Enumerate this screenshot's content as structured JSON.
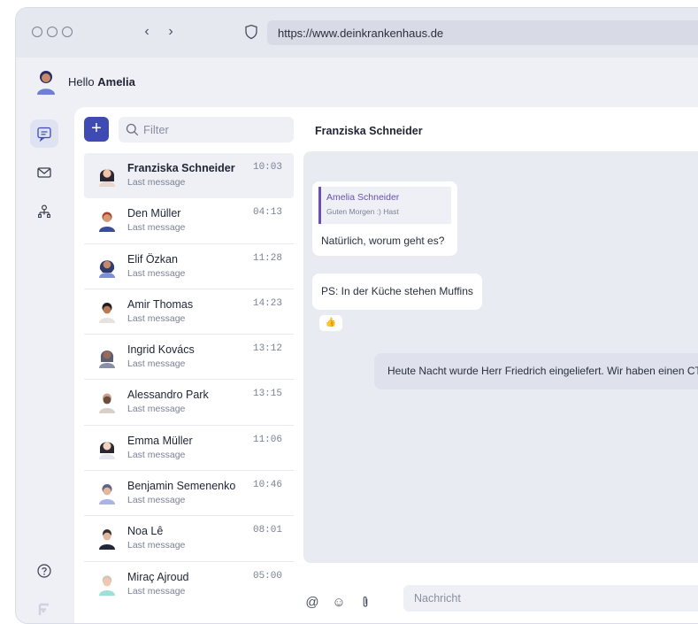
{
  "browser": {
    "url": "https://www.deinkrankenhaus.de",
    "back": "‹",
    "forward": "›"
  },
  "header": {
    "greeting": "Hello",
    "user_name": "Amelia"
  },
  "sidebar": {
    "icons": [
      "chat-icon",
      "mail-icon",
      "org-chart-icon"
    ],
    "help_icon": "help-icon",
    "logo_icon": "app-logo-icon"
  },
  "chat_list": {
    "add_label": "+",
    "filter_placeholder": "Filter",
    "items": [
      {
        "name": "Franziska Schneider",
        "subtitle": "Last message",
        "time": "10:03"
      },
      {
        "name": "Den Müller",
        "subtitle": "Last message",
        "time": "04:13"
      },
      {
        "name": "Elif Özkan",
        "subtitle": "Last message",
        "time": "11:28"
      },
      {
        "name": "Amir Thomas",
        "subtitle": "Last message",
        "time": "14:23"
      },
      {
        "name": "Ingrid Kovács",
        "subtitle": "Last message",
        "time": "13:12"
      },
      {
        "name": "Alessandro Park",
        "subtitle": "Last message",
        "time": "13:15"
      },
      {
        "name": "Emma Müller",
        "subtitle": "Last message",
        "time": "11:06"
      },
      {
        "name": "Benjamin Semenenko",
        "subtitle": "Last message",
        "time": "10:46"
      },
      {
        "name": "Noa Lê",
        "subtitle": "Last message",
        "time": "08:01"
      },
      {
        "name": "Miraç Ajroud",
        "subtitle": "Last message",
        "time": "05:00"
      }
    ]
  },
  "conversation": {
    "title": "Franziska Schneider",
    "quote_name": "Amelia Schneider",
    "quote_text": "Guten Morgen :) Hast",
    "msg1": "Natürlich, worum geht es?",
    "msg2": "PS: In der Küche stehen Muffins",
    "reaction": "👍",
    "msg3": "Heute Nacht wurde Herr Friedrich eingeliefert. Wir haben einen CT ge"
  },
  "composer": {
    "mention_label": "@",
    "emoji_label": "☺",
    "attach_label": "📎",
    "placeholder": "Nachricht"
  },
  "colors": {
    "accent": "#3f4ab3",
    "quote_accent": "#6a4fb0",
    "background": "#eef0f6"
  }
}
